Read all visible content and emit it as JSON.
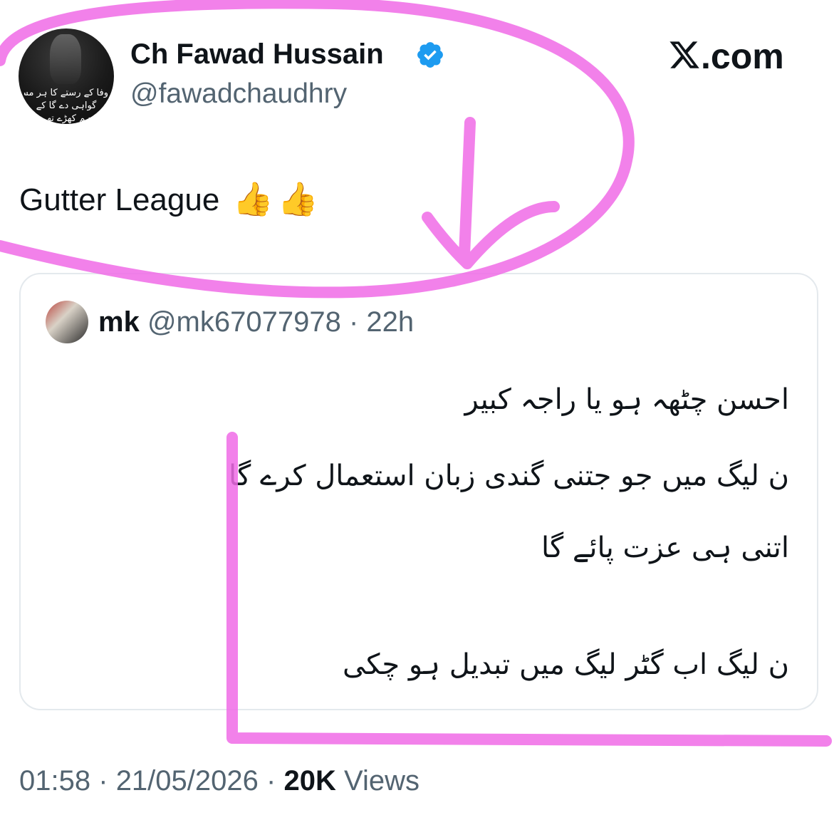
{
  "tweet": {
    "author": {
      "display_name": "Ch Fawad Hussain",
      "handle": "@fawadchaudhry",
      "avatar_caption": [
        "وفا کے رستے کا ہر مسافر",
        "گواہی دے گا کے",
        "ہم کھڑے تھے"
      ],
      "verified": true
    },
    "brand": {
      "label": ".com"
    },
    "text": "Gutter League",
    "emoji": [
      "👍",
      "👍"
    ],
    "quoted": {
      "name": "mk",
      "handle": "@mk67077978",
      "separator": "·",
      "time": "22h",
      "lines": [
        "احسن چٹھہ ہو یا راجہ کبیر",
        "ن لیگ میں جو جتنی گندی زبان استعمال کرے گا",
        "اتنی ہی عزت پائے گا",
        "ن لیگ اب گٹر لیگ میں تبدیل ہو چکی"
      ]
    },
    "meta": {
      "time": "01:58",
      "sep1": "·",
      "date": "21/05/2026",
      "sep2": "·",
      "views_count": "20K",
      "views_label": "Views"
    }
  },
  "colors": {
    "text_primary": "#0f1419",
    "text_secondary": "#536471",
    "verified_blue": "#1d9bf0",
    "annotation_pink": "#f06be6",
    "card_border": "#e4e9ed"
  },
  "icons": [
    "verified-badge-icon",
    "x-logo-icon",
    "thumbs-up-icon"
  ]
}
